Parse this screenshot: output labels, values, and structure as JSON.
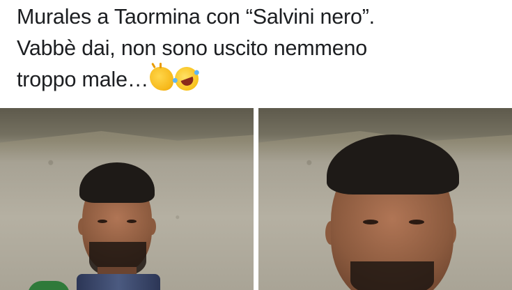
{
  "post": {
    "lines": [
      "Murales a Taormina con “Salvini nero”.",
      "Vabbè dai, non sono uscito nemmeno",
      "troppo male…"
    ],
    "emojis": [
      "clapping-hands-emoji",
      "rolling-on-floor-laughing-emoji"
    ]
  },
  "images": [
    {
      "name": "mural-photo-left"
    },
    {
      "name": "mural-photo-right"
    }
  ]
}
